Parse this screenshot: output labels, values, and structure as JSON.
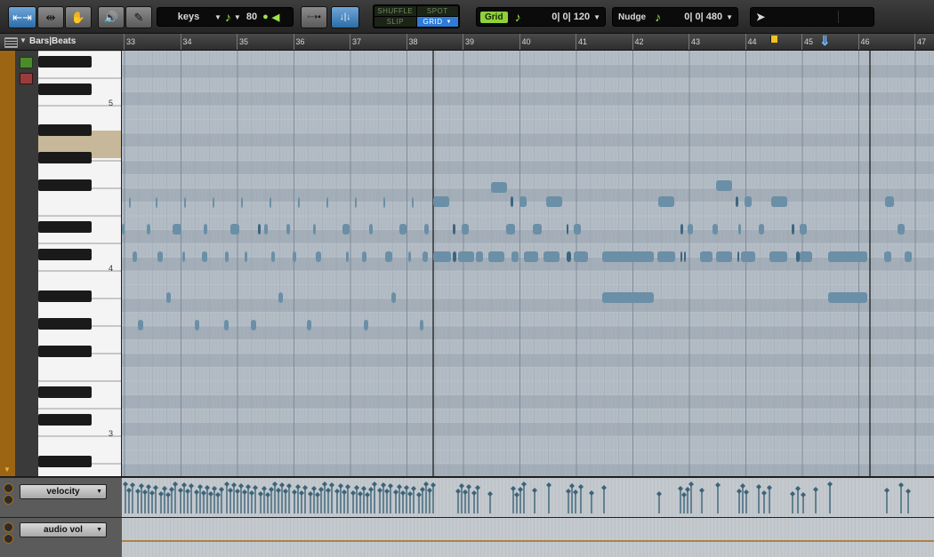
{
  "toolbar": {
    "track_name": "keys",
    "note_duration": "80",
    "edit_modes": {
      "shuffle": "SHUFFLE",
      "spot": "SPOT",
      "slip": "SLIP",
      "grid": "GRID"
    },
    "grid_label": "Grid",
    "grid_value": "0| 0| 120",
    "nudge_label": "Nudge",
    "nudge_value": "0| 0| 480"
  },
  "ruler": {
    "label": "Bars|Beats",
    "bars": [
      "33",
      "34",
      "35",
      "36",
      "37",
      "38",
      "39",
      "40",
      "41",
      "42",
      "43",
      "44",
      "45",
      "46",
      "47"
    ]
  },
  "keyboard": {
    "octave_labels": [
      "5",
      "4",
      "3"
    ]
  },
  "lanes": [
    {
      "label": "velocity"
    },
    {
      "label": "audio vol"
    }
  ],
  "colors": {
    "note": "#6a8fa6",
    "note_dark": "#3c6680",
    "track_strip": "#9c6514",
    "mode_on": "#2e7cd8",
    "lcd_green": "#9ee34a"
  }
}
